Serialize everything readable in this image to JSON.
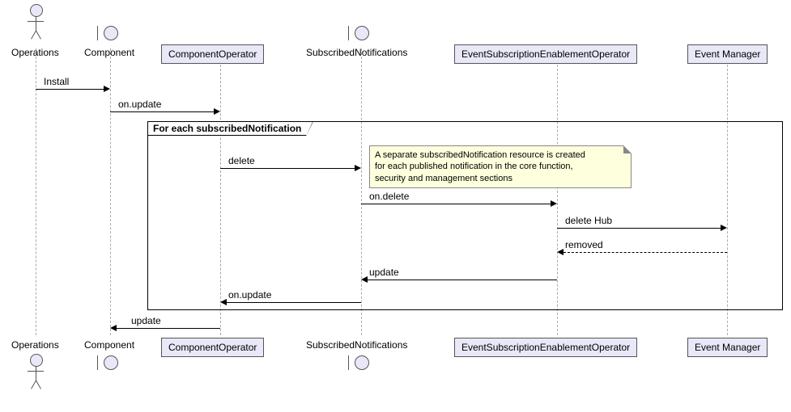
{
  "participants": {
    "operations": "Operations",
    "component": "Component",
    "componentOperator": "ComponentOperator",
    "subscribedNotifications": "SubscribedNotifications",
    "eseOperator": "EventSubscriptionEnablementOperator",
    "eventManager": "Event Manager"
  },
  "loop": {
    "title": "For each subscribedNotification"
  },
  "note": {
    "line1": "A separate subscribedNotification resource is created",
    "line2": "for each published notification in the core function,",
    "line3": "security and management sections"
  },
  "messages": {
    "install": "Install",
    "onUpdate1": "on.update",
    "delete": "delete",
    "onDelete": "on.delete",
    "deleteHub": "delete Hub",
    "removed": "removed",
    "updateReturn": "update",
    "onUpdateReturn": "on.update",
    "updateFinal": "update"
  },
  "chart_data": {
    "type": "sequence-diagram",
    "participants": [
      {
        "name": "Operations",
        "kind": "actor"
      },
      {
        "name": "Component",
        "kind": "boundary"
      },
      {
        "name": "ComponentOperator",
        "kind": "participant"
      },
      {
        "name": "SubscribedNotifications",
        "kind": "boundary"
      },
      {
        "name": "EventSubscriptionEnablementOperator",
        "kind": "participant"
      },
      {
        "name": "Event Manager",
        "kind": "participant"
      }
    ],
    "messages": [
      {
        "from": "Operations",
        "to": "Component",
        "label": "Install",
        "style": "solid"
      },
      {
        "from": "Component",
        "to": "ComponentOperator",
        "label": "on.update",
        "style": "solid"
      },
      {
        "loop": "For each subscribedNotification",
        "messages": [
          {
            "from": "ComponentOperator",
            "to": "SubscribedNotifications",
            "label": "delete",
            "style": "solid",
            "note": "A separate subscribedNotification resource is created for each published notification in the core function, security and management sections"
          },
          {
            "from": "SubscribedNotifications",
            "to": "EventSubscriptionEnablementOperator",
            "label": "on.delete",
            "style": "solid"
          },
          {
            "from": "EventSubscriptionEnablementOperator",
            "to": "Event Manager",
            "label": "delete Hub",
            "style": "solid"
          },
          {
            "from": "Event Manager",
            "to": "EventSubscriptionEnablementOperator",
            "label": "removed",
            "style": "dashed"
          },
          {
            "from": "EventSubscriptionEnablementOperator",
            "to": "SubscribedNotifications",
            "label": "update",
            "style": "solid"
          },
          {
            "from": "SubscribedNotifications",
            "to": "ComponentOperator",
            "label": "on.update",
            "style": "solid"
          }
        ]
      },
      {
        "from": "ComponentOperator",
        "to": "Component",
        "label": "update",
        "style": "solid"
      }
    ]
  }
}
